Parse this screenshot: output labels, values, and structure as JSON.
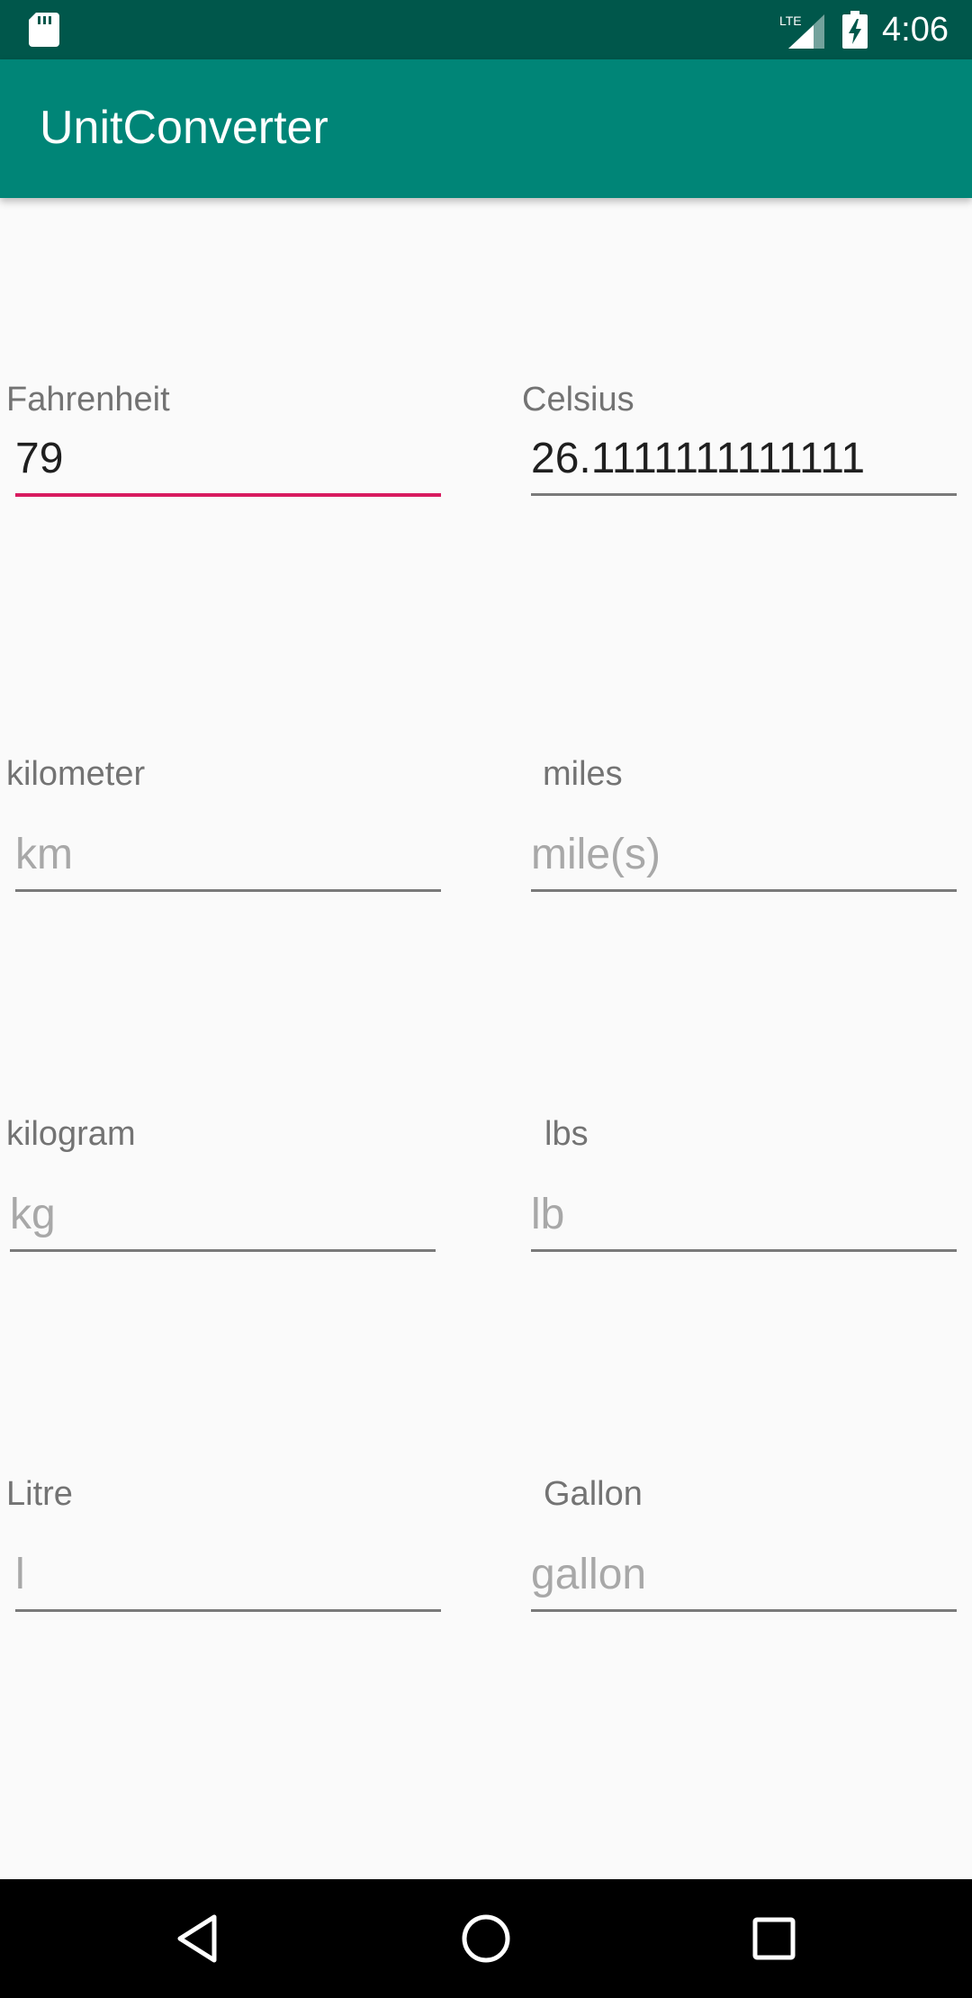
{
  "status_bar": {
    "time": "4:06",
    "network": "LTE",
    "icons": [
      "sd-card-icon",
      "lte-signal-icon",
      "battery-charging-icon"
    ]
  },
  "app_bar": {
    "title": "UnitConverter"
  },
  "converters": {
    "temperature": {
      "left_label": "Fahrenheit",
      "left_value": "79",
      "right_label": "Celsius",
      "right_value": "26.1111111111111"
    },
    "distance": {
      "left_label": "kilometer",
      "left_placeholder": "km",
      "right_label": "miles",
      "right_placeholder": "mile(s)"
    },
    "weight": {
      "left_label": "kilogram",
      "left_placeholder": "kg",
      "right_label": "lbs",
      "right_placeholder": "lb"
    },
    "volume": {
      "left_label": "Litre",
      "left_placeholder": "l",
      "right_label": "Gallon",
      "right_placeholder": "gallon"
    }
  },
  "nav_bar": {
    "buttons": [
      "back-icon",
      "home-icon",
      "recents-icon"
    ]
  },
  "colors": {
    "status_bar": "#00574b",
    "app_bar": "#008577",
    "accent": "#d81b60",
    "background": "#fafafa"
  }
}
